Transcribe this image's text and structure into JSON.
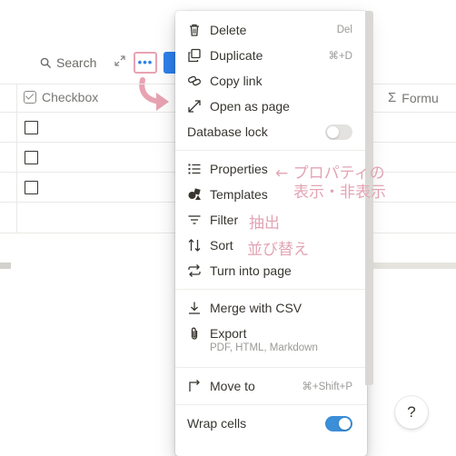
{
  "toolbar": {
    "search_label": "Search"
  },
  "table": {
    "header_checkbox": "Checkbox",
    "header_formula": "Formu",
    "rows": 3
  },
  "menu": {
    "delete": {
      "label": "Delete",
      "shortcut": "Del"
    },
    "duplicate": {
      "label": "Duplicate",
      "shortcut": "⌘+D"
    },
    "copy_link": {
      "label": "Copy link"
    },
    "open_as_page": {
      "label": "Open as page"
    },
    "database_lock": {
      "label": "Database lock",
      "enabled": false
    },
    "properties": {
      "label": "Properties"
    },
    "templates": {
      "label": "Templates"
    },
    "filter": {
      "label": "Filter"
    },
    "sort": {
      "label": "Sort"
    },
    "turn_into_page": {
      "label": "Turn into page"
    },
    "merge_csv": {
      "label": "Merge with CSV"
    },
    "export": {
      "label": "Export",
      "sublabel": "PDF, HTML, Markdown"
    },
    "move_to": {
      "label": "Move to",
      "shortcut": "⌘+Shift+P"
    },
    "wrap_cells": {
      "label": "Wrap cells",
      "enabled": true
    }
  },
  "annotations": {
    "properties_line1": "← プロパティの",
    "properties_line2": "表示・非表示",
    "filter": "抽出",
    "sort": "並び替え"
  },
  "help": {
    "label": "?"
  },
  "colors": {
    "accent": "#2f80ed",
    "annotation": "#e3a4b5",
    "toggle_on": "#3b8ed8"
  }
}
